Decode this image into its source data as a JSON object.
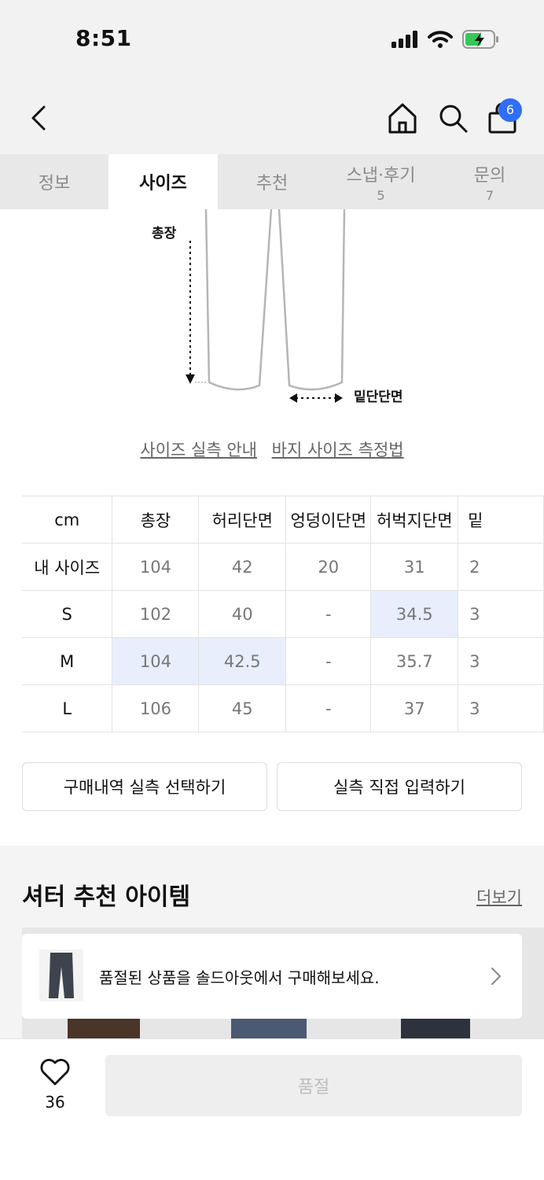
{
  "status_bar": {
    "time": "8:51"
  },
  "nav": {
    "cart_count": "6"
  },
  "tabs": [
    {
      "label": "정보",
      "count": ""
    },
    {
      "label": "사이즈",
      "count": ""
    },
    {
      "label": "추천",
      "count": ""
    },
    {
      "label": "스냅·후기",
      "count": "5"
    },
    {
      "label": "문의",
      "count": "7"
    }
  ],
  "diagram": {
    "length_label": "총장",
    "hem_label": "밑단단면"
  },
  "links": {
    "actual_size_guide": "사이즈 실측 안내",
    "pants_measure": "바지 사이즈 측정법"
  },
  "size_table": {
    "headers": [
      "cm",
      "총장",
      "허리단면",
      "엉덩이단면",
      "허벅지단면",
      "밑"
    ],
    "rows": [
      {
        "label": "내 사이즈",
        "cells": [
          "104",
          "42",
          "20",
          "31",
          "2"
        ]
      },
      {
        "label": "S",
        "cells": [
          "102",
          "40",
          "-",
          "34.5",
          "3"
        ]
      },
      {
        "label": "M",
        "cells": [
          "104",
          "42.5",
          "-",
          "35.7",
          "3"
        ]
      },
      {
        "label": "L",
        "cells": [
          "106",
          "45",
          "-",
          "37",
          "3"
        ]
      }
    ],
    "highlight_color": "#e8eefc"
  },
  "buttons": {
    "select_purchase": "구매내역 실측 선택하기",
    "manual_input": "실측 직접 입력하기"
  },
  "recommend": {
    "title": "셔터 추천 아이템",
    "more": "더보기",
    "soldout_message": "품절된 상품을 솔드아웃에서 구매해보세요."
  },
  "bottom": {
    "like_count": "36",
    "buy_label": "품절"
  },
  "colors": {
    "accent": "#2f6ef5"
  }
}
